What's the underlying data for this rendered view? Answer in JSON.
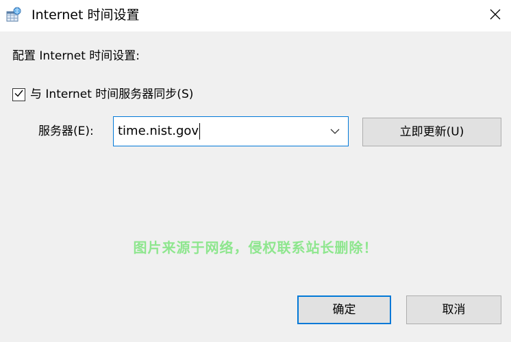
{
  "window": {
    "title": "Internet 时间设置",
    "icon": "internet-time-icon",
    "close_icon": "close-icon"
  },
  "dialog": {
    "heading": "配置 Internet 时间设置:",
    "sync_checkbox": {
      "label": "与 Internet 时间服务器同步(S)",
      "checked": true
    },
    "server": {
      "label": "服务器(E):",
      "value": "time.nist.gov",
      "dropdown_icon": "chevron-down-icon"
    },
    "update_button": "立即更新(U)",
    "watermark": "图片来源于网络，侵权联系站长删除！",
    "ok_button": "确定",
    "cancel_button": "取消"
  },
  "colors": {
    "accent": "#0078d7",
    "watermark": "#8ee68e"
  }
}
